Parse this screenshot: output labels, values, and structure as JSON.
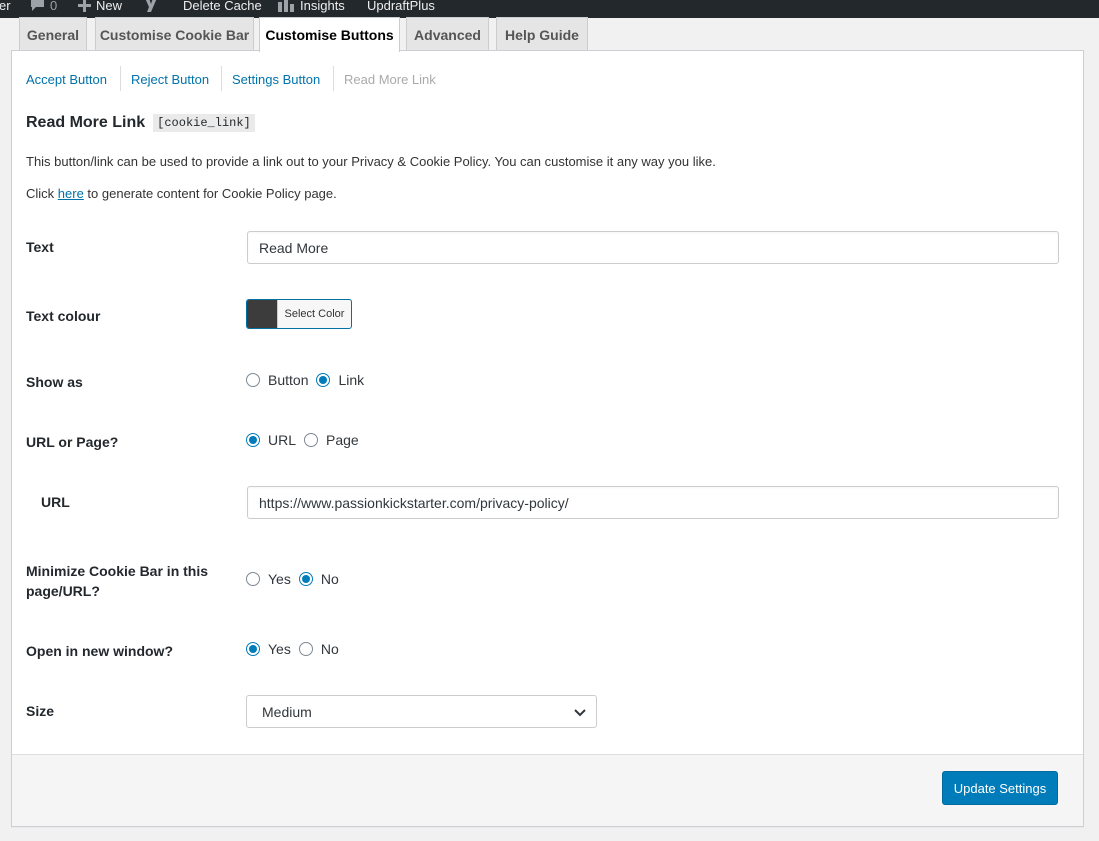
{
  "admin_bar": {
    "item_partial": "er",
    "comments_count": "0",
    "new_label": "New",
    "delete_cache_label": "Delete Cache",
    "insights_label": "Insights",
    "updraft_label": "UpdraftPlus"
  },
  "tabs": [
    {
      "label": "General",
      "active": false
    },
    {
      "label": "Customise Cookie Bar",
      "active": false
    },
    {
      "label": "Customise Buttons",
      "active": true
    },
    {
      "label": "Advanced",
      "active": false
    },
    {
      "label": "Help Guide",
      "active": false
    }
  ],
  "subnav": [
    {
      "label": "Accept Button"
    },
    {
      "label": "Reject Button"
    },
    {
      "label": "Settings Button"
    },
    {
      "label": "Read More Link",
      "current": true
    }
  ],
  "section": {
    "title": "Read More Link",
    "shortcode": "[cookie_link]",
    "description": "This button/link can be used to provide a link out to your Privacy & Cookie Policy. You can customise it any way you like.",
    "click_prefix": "Click ",
    "here_link": "here",
    "click_suffix": " to generate content for Cookie Policy page."
  },
  "fields": {
    "text": {
      "label": "Text",
      "value": "Read More"
    },
    "text_colour": {
      "label": "Text colour",
      "button_label": "Select Color",
      "swatch_color": "#3c3c3c"
    },
    "show_as": {
      "label": "Show as",
      "options": [
        "Button",
        "Link"
      ],
      "selected": "Link"
    },
    "url_or_page": {
      "label": "URL or Page?",
      "options": [
        "URL",
        "Page"
      ],
      "selected": "URL"
    },
    "url": {
      "label": "URL",
      "value": "https://www.passionkickstarter.com/privacy-policy/"
    },
    "minimize": {
      "label_line1": "Minimize Cookie Bar in this",
      "label_line2": "page/URL?",
      "options": [
        "Yes",
        "No"
      ],
      "selected": "No"
    },
    "new_window": {
      "label": "Open in new window?",
      "options": [
        "Yes",
        "No"
      ],
      "selected": "Yes"
    },
    "size": {
      "label": "Size",
      "value": "Medium"
    }
  },
  "actions": {
    "update_label": "Update Settings"
  },
  "colors": {
    "accent": "#007cba",
    "link": "#0073aa",
    "admin_bar": "#23282d"
  }
}
